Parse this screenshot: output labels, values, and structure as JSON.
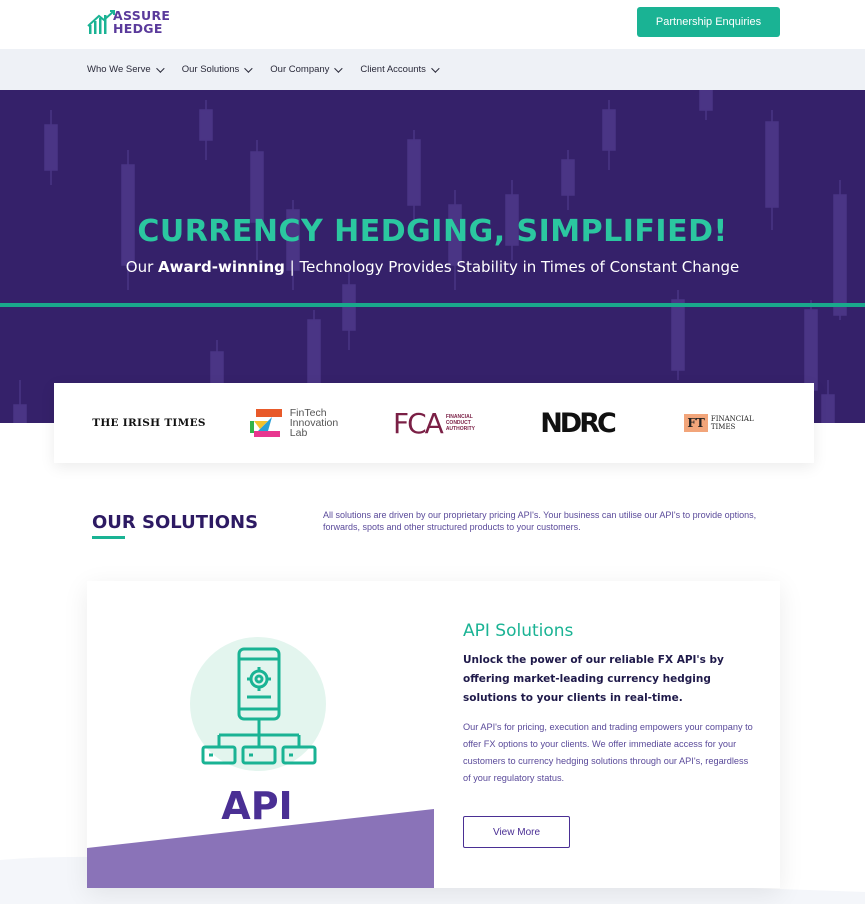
{
  "header": {
    "logo_line1": "ASSURE",
    "logo_line2": "HEDGE",
    "cta_label": "Partnership Enquiries"
  },
  "nav": {
    "items": [
      {
        "label": "Who We Serve"
      },
      {
        "label": "Our Solutions"
      },
      {
        "label": "Our Company"
      },
      {
        "label": "Client Accounts"
      }
    ]
  },
  "hero": {
    "title": "CURRENCY HEDGING, SIMPLIFIED!",
    "sub_prefix": "Our ",
    "sub_bold": "Award-winning",
    "sub_suffix": " | Technology Provides Stability in Times of Constant Change"
  },
  "partners": {
    "irish_times": "THE IRISH TIMES",
    "fintech_line1": "FinTech",
    "fintech_line2": "Innovation",
    "fintech_line3": "Lab",
    "fca_mark": "FCA",
    "fca_line1": "FINANCIAL",
    "fca_line2": "CONDUCT",
    "fca_line3": "AUTHORITY",
    "ndrc": "NDRC",
    "ft_mark": "FT",
    "ft_line1": "FINANCIAL",
    "ft_line2": "TIMES"
  },
  "solutions": {
    "title": "OUR SOLUTIONS",
    "description": "All solutions are driven by our proprietary pricing API's. Your business can utilise our API's to provide options, forwards, spots and other structured products to your customers."
  },
  "card": {
    "image_label": "API",
    "title": "API Solutions",
    "lead": "Unlock the power of our reliable FX API's by offering market-leading currency hedging solutions to your clients in real-time.",
    "body": "Our API's for pricing, execution and trading empowers your company to offer FX options to your clients. We offer immediate access for your customers to currency hedging solutions through our API's, regardless of your regulatory status.",
    "button_label": "View More"
  },
  "colors": {
    "brand_purple": "#35216a",
    "brand_teal": "#1ab394",
    "nav_bg": "#eef1f6"
  }
}
